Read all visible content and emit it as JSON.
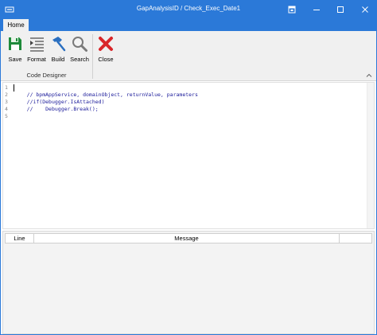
{
  "window": {
    "title": "GapAnalysisID / Check_Exec_Date1"
  },
  "tabs": [
    {
      "label": "Home",
      "active": true
    }
  ],
  "ribbon": {
    "buttons": [
      {
        "id": "save",
        "label": "Save",
        "icon": "save-icon",
        "color": "#1e8a3a"
      },
      {
        "id": "format",
        "label": "Format",
        "icon": "format-icon",
        "color": "#7a7a7a"
      },
      {
        "id": "build",
        "label": "Build",
        "icon": "hammer-icon",
        "color": "#2a6fc0"
      },
      {
        "id": "search",
        "label": "Search",
        "icon": "search-icon",
        "color": "#7a7a7a"
      },
      {
        "id": "close",
        "label": "Close",
        "icon": "close-icon",
        "color": "#d9262a"
      }
    ],
    "group_label": "Code Designer"
  },
  "editor": {
    "lines": [
      {
        "num": "1",
        "text": ""
      },
      {
        "num": "2",
        "text": "    // bpmAppService, domainObject, returnValue, parameters"
      },
      {
        "num": "3",
        "text": "    //if(Debugger.IsAttached)"
      },
      {
        "num": "4",
        "text": "    //    Debugger.Break();"
      },
      {
        "num": "5",
        "text": ""
      }
    ]
  },
  "messages": {
    "columns": [
      "Line",
      "Message"
    ],
    "rows": []
  },
  "colors": {
    "titlebar": "#2b79d8",
    "ribbon": "#f0f0f0",
    "code_comment": "#1a1a9a"
  }
}
